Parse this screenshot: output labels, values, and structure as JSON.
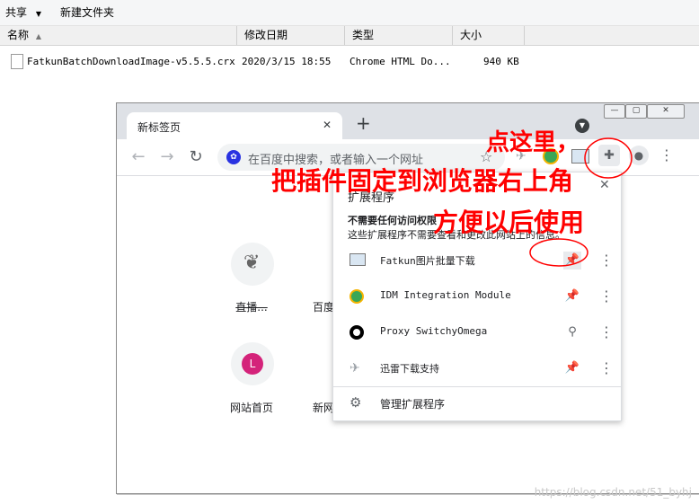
{
  "explorer": {
    "toolbar": {
      "share": "共享",
      "share_arrow": "▼",
      "new_folder": "新建文件夹"
    },
    "columns": {
      "name": "名称",
      "modified": "修改日期",
      "type": "类型",
      "size": "大小"
    },
    "file": {
      "name": "FatkunBatchDownloadImage-v5.5.5.crx",
      "modified": "2020/3/15 18:55",
      "type": "Chrome HTML Do...",
      "size": "940 KB"
    }
  },
  "chrome": {
    "tab_title": "新标签页",
    "tab_close": "✕",
    "new_tab": "+",
    "omnibox_placeholder": "在百度中搜索，或者输入一个网址",
    "shortcuts": [
      {
        "label": "直播...",
        "letter": ""
      },
      {
        "label": "百度",
        "letter": ""
      },
      {
        "label": "网站首页",
        "letter": "L"
      },
      {
        "label": "新网",
        "letter": ""
      }
    ],
    "extensions_popup": {
      "title": "扩展程序",
      "subtitle": "不需要任何访问权限",
      "description": "这些扩展程序不需要查看和更改此网站上的信息。",
      "items": [
        {
          "name": "Fatkun图片批量下载",
          "pinned": true
        },
        {
          "name": "IDM Integration Module",
          "pinned": true
        },
        {
          "name": "Proxy SwitchyOmega",
          "pinned": false
        },
        {
          "name": "迅雷下载支持",
          "pinned": true
        }
      ],
      "manage": "管理扩展程序"
    }
  },
  "annotations": {
    "click_here": "点这里，",
    "line1": "把插件固定到浏览器右上角",
    "line2": "方便以后使用"
  },
  "watermark": "https://blog.csdn.net/51_byhj",
  "colors": {
    "annotation": "#ff0000",
    "pin_active": "#1a73e8",
    "avatar_L": "#d4237a"
  }
}
